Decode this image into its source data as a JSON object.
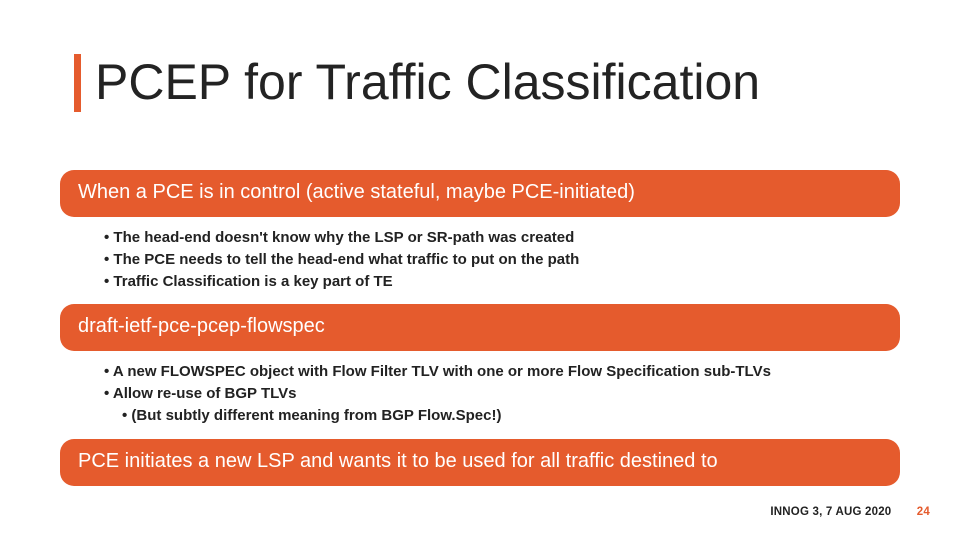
{
  "title": "PCEP for Traffic Classification",
  "sections": [
    {
      "heading": "When a PCE is in control (active stateful, maybe PCE-initiated)",
      "bullets": [
        {
          "text": "The head-end doesn't know why the LSP or SR-path was created",
          "indent": false
        },
        {
          "text": "The PCE needs to tell the head-end what traffic to put on the path",
          "indent": false
        },
        {
          "text": "Traffic Classification is a key part of TE",
          "indent": false
        }
      ]
    },
    {
      "heading": "draft-ietf-pce-pcep-flowspec",
      "bullets": [
        {
          "text": "A new FLOWSPEC object with Flow Filter TLV with one or more Flow Specification sub-TLVs",
          "indent": false
        },
        {
          "text": "Allow re-use of BGP TLVs",
          "indent": false
        },
        {
          "text": "(But subtly different meaning from BGP Flow.Spec!)",
          "indent": true
        }
      ]
    },
    {
      "heading": "PCE initiates a new LSP and wants it to be used for all traffic destined to",
      "bullets": []
    }
  ],
  "footer": {
    "event": "INNOG 3, 7 AUG 2020",
    "page": "24"
  }
}
